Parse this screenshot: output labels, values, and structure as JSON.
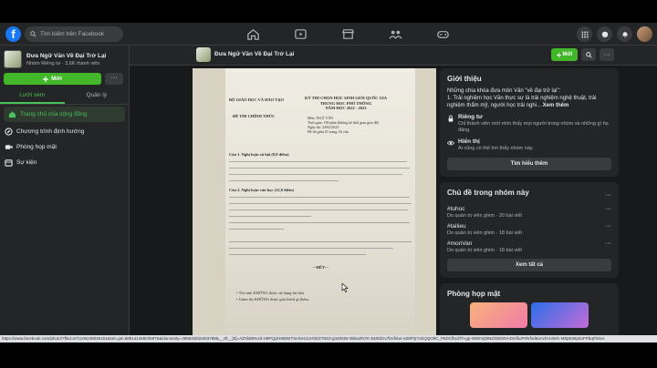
{
  "topbar": {
    "logo_letter": "f",
    "search_placeholder": "Tìm kiếm trên Facebook"
  },
  "group": {
    "title": "Đưa Ngữ Văn Về Đại Trở Lại",
    "subtitle": "Nhóm Riêng tư · 3,6K thành viên",
    "join_label": "Mới",
    "more_label": "···"
  },
  "sidebar": {
    "tabs": [
      {
        "label": "Lướt xem"
      },
      {
        "label": "Quản lý"
      }
    ],
    "items": [
      {
        "label": "Trang chủ của cộng đồng"
      },
      {
        "label": "Chương trình định hướng"
      },
      {
        "label": "Phòng họp mặt"
      },
      {
        "label": "Sự kiện"
      }
    ]
  },
  "groupbar": {
    "title": "Đưa Ngữ Văn Về Đại Trở Lại",
    "join_label": "Mới"
  },
  "document": {
    "left_header": "BỘ GIÁO DỤC VÀ ĐÀO TẠO",
    "right_header": [
      "KỲ THI CHỌN HỌC SINH GIỎI QUỐC GIA",
      "TRUNG HỌC PHỔ THÔNG",
      "NĂM HỌC 2022 - 2023"
    ],
    "official": "ĐỀ THI CHÍNH THỨC",
    "meta": [
      "Môn: NGỮ VĂN",
      "Thời gian: 180 phút (không kể thời gian giao đề)",
      "Ngày thi: 24/02/2023",
      "Đề thi gồm 01 trang, 02 câu"
    ],
    "q1_head": "Câu 1. Nghị luận xã hội (8,0 điểm)",
    "q2_head": "Câu 2. Nghị luận văn học (12,0 điểm)",
    "end": "---HẾT---",
    "note1": "• Thí sinh KHÔNG được sử dụng tài liệu.",
    "note2": "• Giám thị KHÔNG được giải thích gì thêm."
  },
  "intro": {
    "heading": "Giới thiệu",
    "text_start": "Những chia khóa đưa môn Văn \"về đại trở lại\":",
    "text_rest": "1. Trải nghiệm học Văn thực sự là trải nghiệm nghệ thuật, trải nghiệm thẩm mỹ, người học trải nghi...",
    "see_more": "Xem thêm",
    "private_title": "Riêng tư",
    "private_desc": "Chỉ thành viên mới nhìn thấy mọi người trong nhóm và những gì họ đăng.",
    "visible_title": "Hiển thị",
    "visible_desc": "Ai cũng có thể tìm thấy nhóm này.",
    "learn_more": "Tìm hiểu thêm"
  },
  "topics": {
    "heading": "Chủ đề trong nhóm này",
    "items": [
      {
        "tag": "#tuhoc",
        "desc": "Do quản trị viên ghim · 20 bài viết"
      },
      {
        "tag": "#tailieu",
        "desc": "Do quản trị viên ghim · 18 bài viết"
      },
      {
        "tag": "#monVan",
        "desc": "Do quản trị viên ghim · 18 bài viết"
      }
    ],
    "see_all": "Xem tất cả"
  },
  "rooms": {
    "heading": "Phòng họp mặt"
  },
  "statusbar": {
    "url": "https://www.facebook.com/photo/?fbid=571106248036151&set=gm.589141466035976&idorvanity=489634816453788&__cft__[0]=AZXk88%2d-H9PQjJH6BWrTSer5H11rHhEZT8S3-gm8N38-rBkiwZN7K-8480Zzv7bVfdue-eZ8PQ7cDQQO9C_P6DCfbcdTh-gp-WWmQ9NZ2bD9tVADGfkoPrRrfsd9aAzlH1WzK-M8pE68p5oFPbqFbSxx"
  }
}
